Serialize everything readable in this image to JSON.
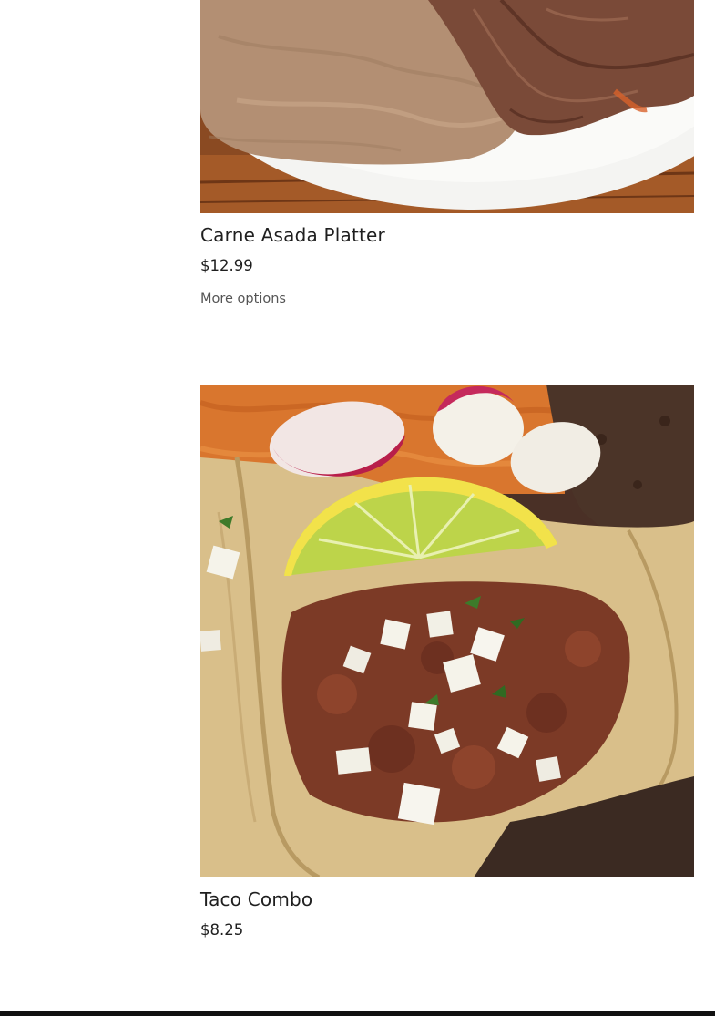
{
  "menu": {
    "items": [
      {
        "name": "Carne Asada Platter",
        "price": "$12.99",
        "options_label": "More options",
        "image_subject": "refried beans and grilled carne asada steak on a white plate"
      },
      {
        "name": "Taco Combo",
        "price": "$8.25",
        "image_subject": "tacos with chorizo, onions, cilantro, lime wedge, radishes, rice and beans"
      }
    ]
  },
  "colors": {
    "text": "#1f1f1f",
    "muted_text": "#555555",
    "footer_bar": "#111111",
    "background": "#ffffff"
  }
}
